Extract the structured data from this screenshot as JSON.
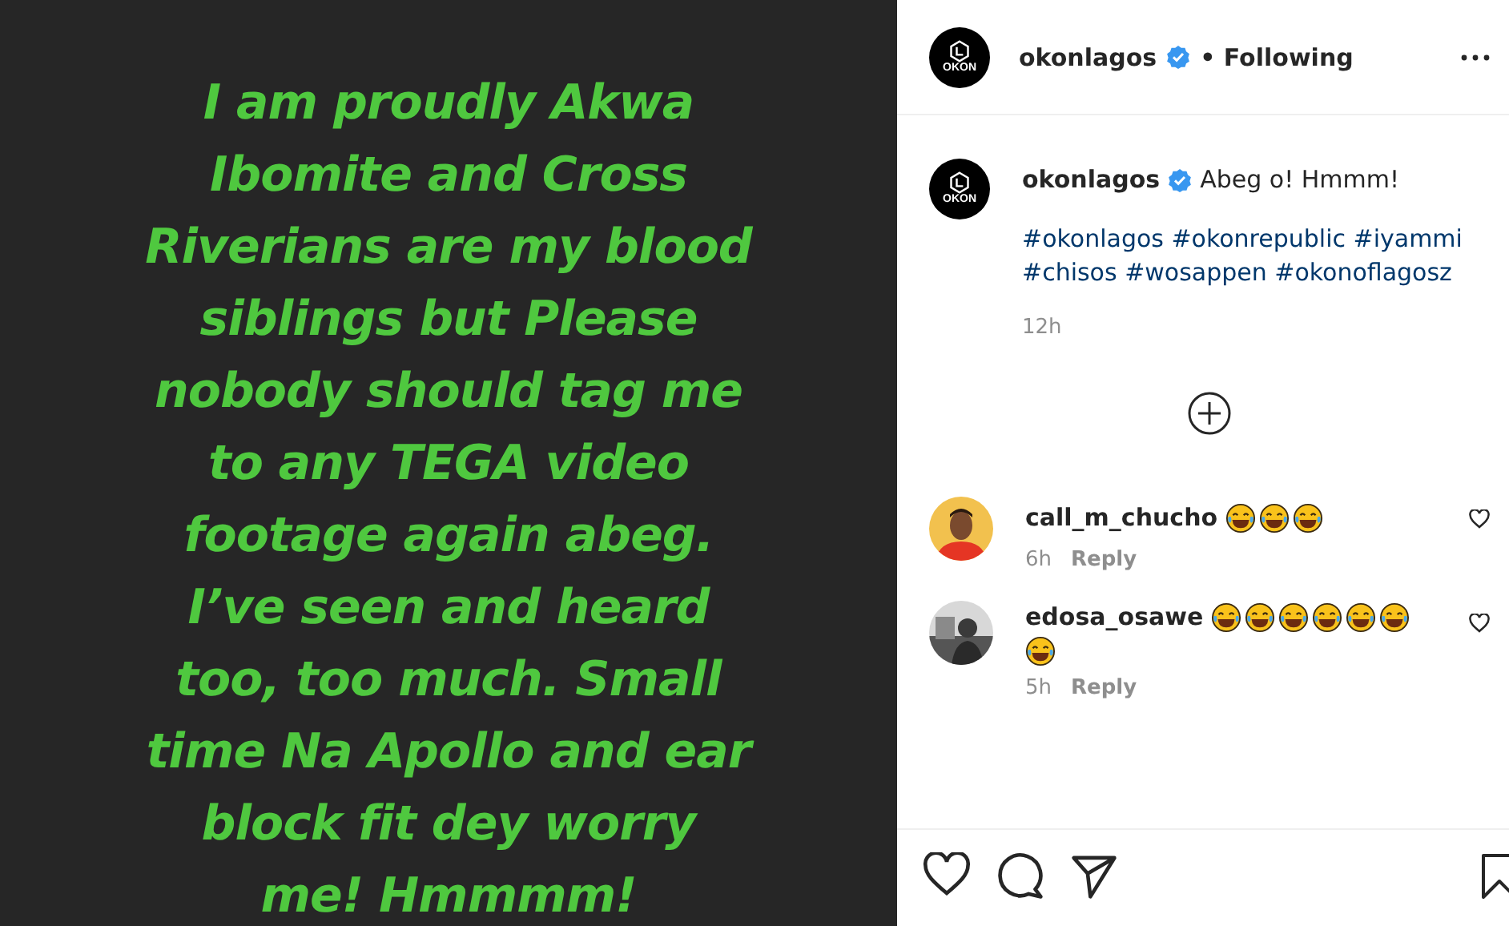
{
  "post_image": {
    "lines": [
      "I am proudly Akwa",
      "Ibomite and Cross",
      "Riverians are my blood",
      "siblings but Please",
      "nobody should tag me",
      "to any TEGA video",
      "footage again abeg.",
      "I’ve seen and heard",
      "too, too much. Small",
      "time Na Apollo and ear",
      "block fit dey worry",
      "me! Hmmmm!"
    ]
  },
  "header": {
    "username": "okonlagos",
    "verified": true,
    "avatar_text": "OKON",
    "follow_status": "• Following"
  },
  "caption": {
    "username": "okonlagos",
    "verified": true,
    "avatar_text": "OKON",
    "text": "Abeg o! Hmmm!",
    "hashtags": "#okonlagos #okonrepublic #iyammi #chisos #wosappen #okonoflagosz",
    "time": "12h"
  },
  "comments": [
    {
      "username": "call_m_chucho",
      "emojis": [
        {
          "kind": "tears-of-joy"
        },
        {
          "kind": "tears-of-joy"
        },
        {
          "kind": "tears-of-joy"
        }
      ],
      "time": "6h",
      "reply": "Reply",
      "liked": false
    },
    {
      "username": "edosa_osawe",
      "emojis": [
        {
          "kind": "tears-of-joy"
        },
        {
          "kind": "tears-of-joy"
        },
        {
          "kind": "tears-of-joy"
        },
        {
          "kind": "tears-of-joy"
        },
        {
          "kind": "tears-of-joy"
        },
        {
          "kind": "tears-of-joy"
        },
        {
          "kind": "tears-of-joy"
        }
      ],
      "time": "5h",
      "reply": "Reply",
      "liked": false
    }
  ]
}
